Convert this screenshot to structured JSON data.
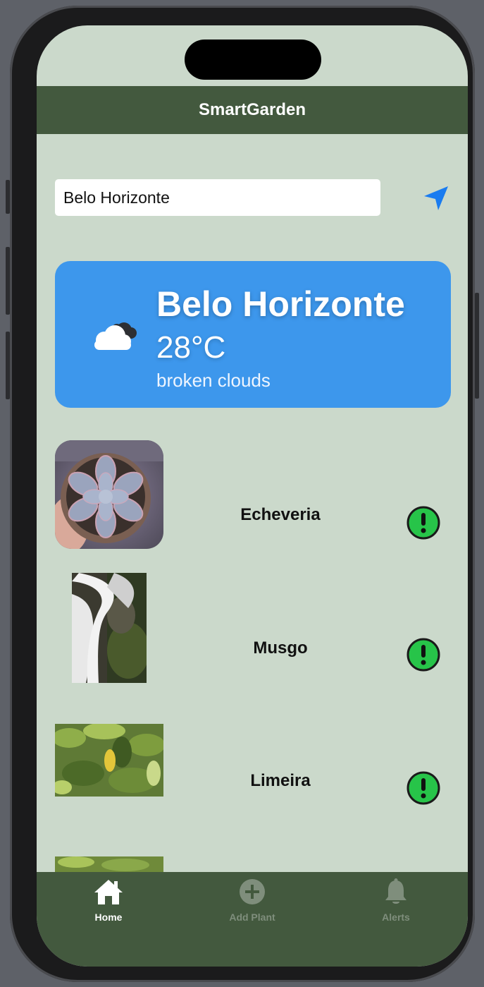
{
  "app": {
    "title": "SmartGarden"
  },
  "search": {
    "value": "Belo Horizonte"
  },
  "location_button": {
    "icon": "location-arrow-icon",
    "color": "#1a7cf0"
  },
  "weather": {
    "city": "Belo Horizonte",
    "temperature": "28°C",
    "description": "broken clouds",
    "icon": "cloud-icon",
    "card_color": "#3d97ec"
  },
  "plants": [
    {
      "name": "Echeveria",
      "status_icon": "exclamation-circle-icon"
    },
    {
      "name": "Musgo",
      "status_icon": "exclamation-circle-icon"
    },
    {
      "name": "Limeira",
      "status_icon": "exclamation-circle-icon"
    }
  ],
  "tabs": [
    {
      "label": "Home",
      "icon": "house-icon",
      "active": true
    },
    {
      "label": "Add Plant",
      "icon": "plus-circle-icon",
      "active": false
    },
    {
      "label": "Alerts",
      "icon": "bell-icon",
      "active": false
    }
  ],
  "colors": {
    "background": "#cbd9cb",
    "bar": "#43593e",
    "alert_fill": "#27c449"
  }
}
